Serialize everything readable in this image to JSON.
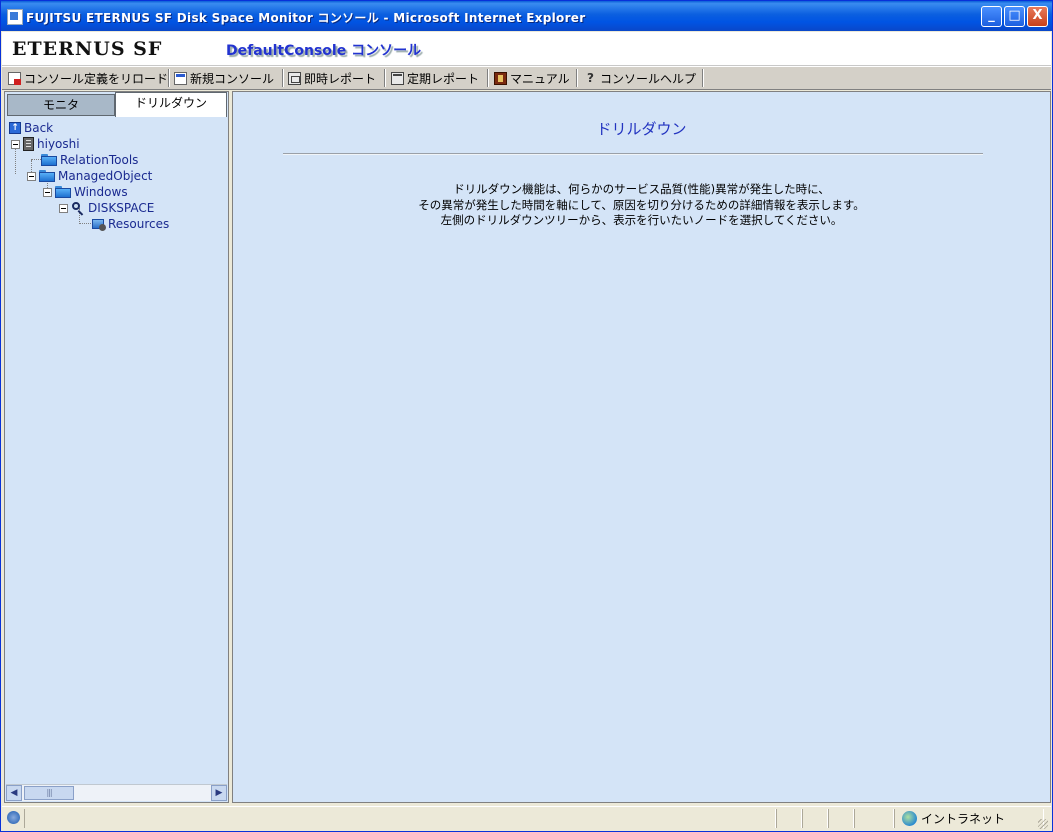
{
  "window": {
    "title": "FUJITSU ETERNUS SF Disk Space Monitor コンソール - Microsoft Internet Explorer",
    "minimize_label": "_",
    "maximize_label": "□",
    "close_label": "X"
  },
  "banner": {
    "brand": "ETERNUS SF",
    "console_title": "DefaultConsole コンソール"
  },
  "toolbar": {
    "reload_label": "コンソール定義をリロード",
    "new_console_label": "新規コンソール",
    "instant_report_label": "即時レポート",
    "periodic_report_label": "定期レポート",
    "manual_label": "マニュアル",
    "console_help_label": "コンソールヘルプ"
  },
  "left_tabs": {
    "monitor_label": "モニタ",
    "drilldown_label": "ドリルダウン"
  },
  "tree": {
    "back": "Back",
    "host": "hiyoshi",
    "relation_tools": "RelationTools",
    "managed_object": "ManagedObject",
    "windows": "Windows",
    "diskspace": "DISKSPACE",
    "resources": "Resources"
  },
  "main": {
    "title": "ドリルダウン",
    "line1": "ドリルダウン機能は、何らかのサービス品質(性能)異常が発生した時に、",
    "line2": "その異常が発生した時間を軸にして、原因を切り分けるための詳細情報を表示します。",
    "line3": "左側のドリルダウンツリーから、表示を行いたいノードを選択してください。"
  },
  "statusbar": {
    "zone": "イントラネット"
  },
  "colors": {
    "titlebar": "#0054e3",
    "pane_bg": "#d4e4f7",
    "link_text": "#1a2a90",
    "heading_text": "#2233c0"
  }
}
